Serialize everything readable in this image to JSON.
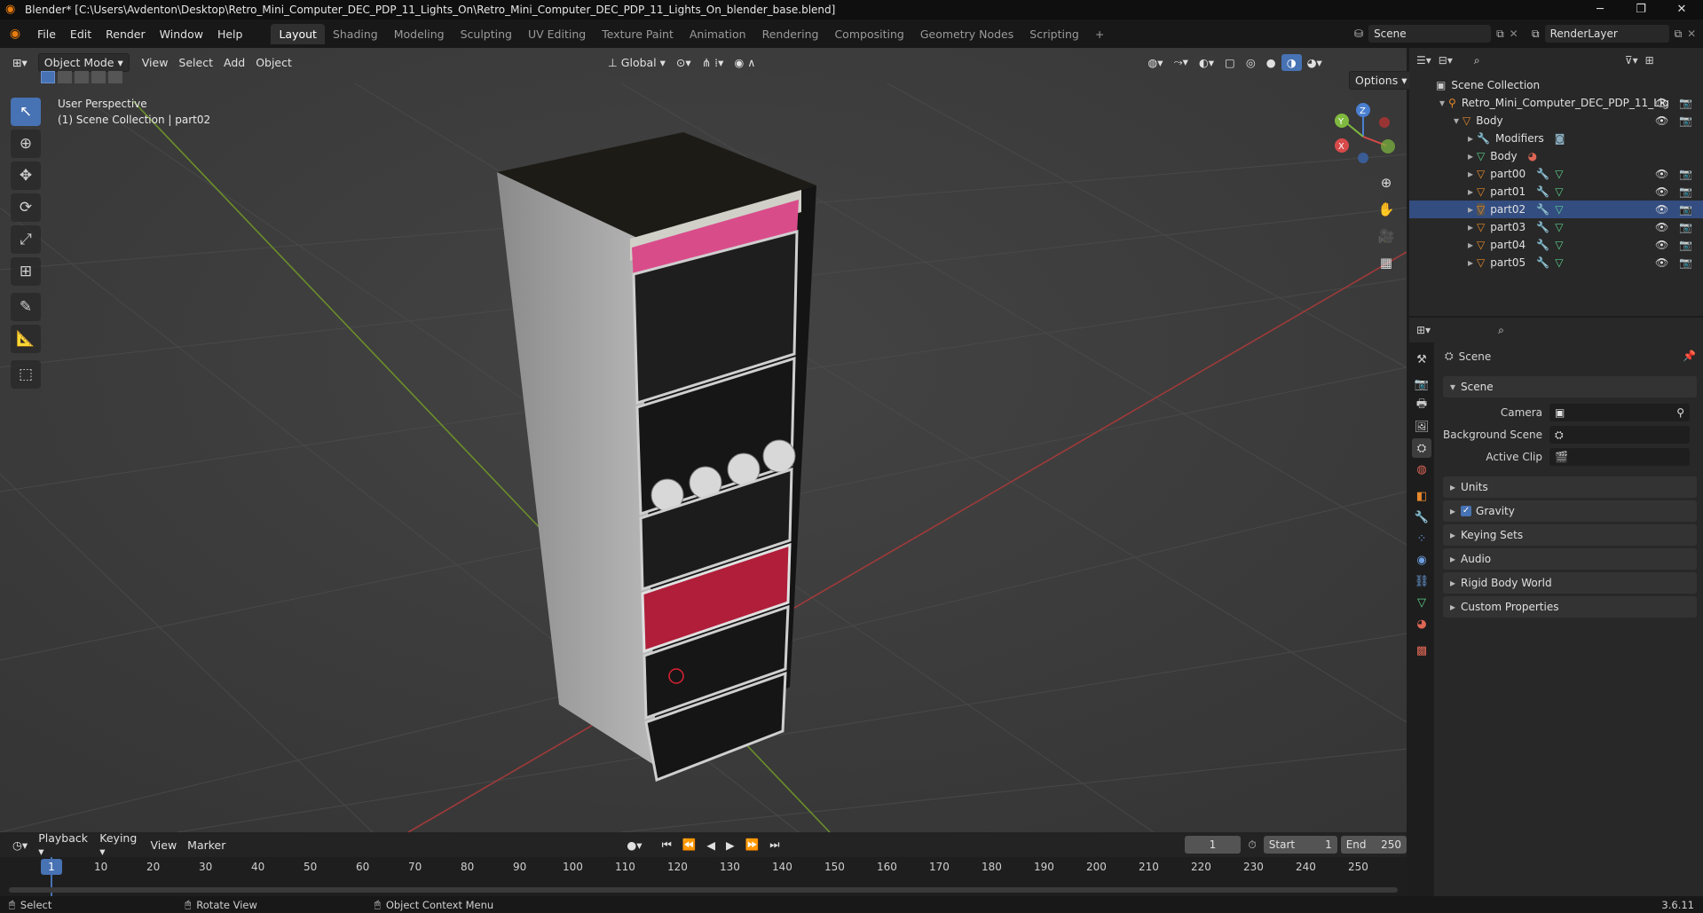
{
  "window": {
    "title": "Blender* [C:\\Users\\Avdenton\\Desktop\\Retro_Mini_Computer_DEC_PDP_11_Lights_On\\Retro_Mini_Computer_DEC_PDP_11_Lights_On_blender_base.blend]",
    "minimize": "─",
    "maximize": "❐",
    "close": "✕"
  },
  "menu": [
    "File",
    "Edit",
    "Render",
    "Window",
    "Help"
  ],
  "workspaces": [
    "Layout",
    "Shading",
    "Modeling",
    "Sculpting",
    "UV Editing",
    "Texture Paint",
    "Animation",
    "Rendering",
    "Compositing",
    "Geometry Nodes",
    "Scripting"
  ],
  "workspace_add": "+",
  "scene_field": "Scene",
  "render_layer_field": "RenderLayer",
  "viewport": {
    "mode": "Object Mode",
    "menus": [
      "View",
      "Select",
      "Add",
      "Object"
    ],
    "transform_orientation": "Global",
    "options": "Options",
    "overlay_line1": "User Perspective",
    "overlay_line2": "(1) Scene Collection | part02",
    "gizmo_z": "Z",
    "gizmo_y": "Y",
    "gizmo_x": "X"
  },
  "outliner": {
    "root": "Scene Collection",
    "collection": "Retro_Mini_Computer_DEC_PDP_11_Lig",
    "body": "Body",
    "modifiers": "Modifiers",
    "body_mesh": "Body",
    "parts": [
      "part00",
      "part01",
      "part02",
      "part03",
      "part04",
      "part05"
    ],
    "selected": "part02"
  },
  "properties": {
    "header": "Scene",
    "section": "Scene",
    "camera_label": "Camera",
    "background_scene_label": "Background Scene",
    "active_clip_label": "Active Clip",
    "panels": [
      "Units",
      "Gravity",
      "Keying Sets",
      "Audio",
      "Rigid Body World",
      "Custom Properties"
    ],
    "gravity_checked": true
  },
  "timeline": {
    "menus": [
      "Playback",
      "Keying",
      "View",
      "Marker"
    ],
    "current_frame": "1",
    "start_label": "Start",
    "start": "1",
    "end_label": "End",
    "end": "250",
    "ruler": [
      "1",
      "10",
      "20",
      "30",
      "40",
      "50",
      "60",
      "70",
      "80",
      "90",
      "100",
      "110",
      "120",
      "130",
      "140",
      "150",
      "160",
      "170",
      "180",
      "190",
      "200",
      "210",
      "220",
      "230",
      "240",
      "250"
    ]
  },
  "status": {
    "select": "Select",
    "rotate": "Rotate View",
    "context": "Object Context Menu",
    "version": "3.6.11"
  },
  "colors": {
    "accent": "#4772b3",
    "selected_row": "#334d80",
    "object_orange": "#e8892c",
    "modifier_blue": "#6d9fe0",
    "mesh_green": "#5ccf8c",
    "axis_red": "#a03a3a",
    "axis_green": "#6b8f2a"
  }
}
